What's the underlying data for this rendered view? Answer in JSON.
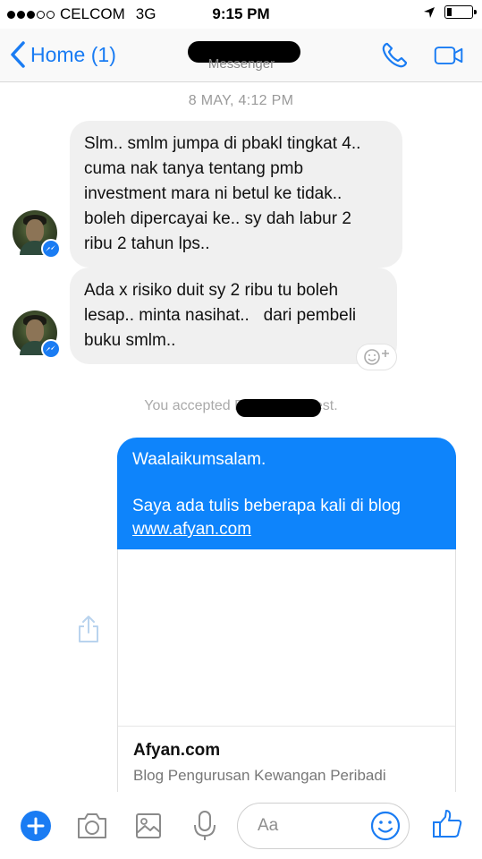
{
  "status_bar": {
    "carrier": "CELCOM",
    "network": "3G",
    "time": "9:15 PM",
    "signal_bars_filled": 3,
    "signal_bars_total": 5,
    "battery_level": 0.2
  },
  "nav": {
    "back_label": "Home (1)",
    "subtitle": "Messenger",
    "accent_color": "#1a7cf3"
  },
  "chat": {
    "timestamp": "8 MAY, 4:12 PM",
    "incoming_messages": [
      {
        "lines": [
          "Slm.. smlm jumpa di pbakl tingkat 4..",
          "cuma nak tanya tentang pmb",
          "investment mara ni betul ke tidak..",
          "boleh dipercayai ke.. sy dah labur 2",
          "ribu 2 tahun lps.."
        ]
      },
      {
        "lines": [
          "Ada x risiko duit sy 2 ribu tu boleh",
          "lesap.. minta nasihat..   dari pembeli",
          "buku smlm.."
        ]
      }
    ],
    "system_message_prefix": "You accepted F",
    "system_message_suffix": "est.",
    "outgoing_message": {
      "line1": "Waalaikumsalam.",
      "line2": "Saya ada tulis beberapa kali di blog",
      "link": "www.afyan.com",
      "bubble_color": "#0e84fb"
    },
    "link_preview": {
      "title": "Afyan.com",
      "description": "Blog Pengurusan Kewangan Peribadi"
    }
  },
  "composer": {
    "placeholder": "Aa",
    "icons": [
      "plus-icon",
      "camera-icon",
      "image-icon",
      "microphone-icon",
      "emoji-icon",
      "thumbs-up-icon"
    ]
  }
}
